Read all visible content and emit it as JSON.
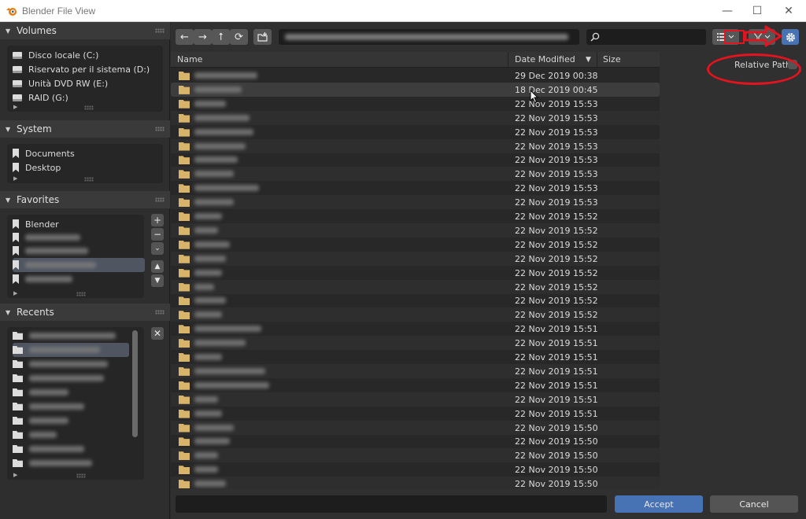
{
  "window": {
    "title": "Blender File View",
    "minimize": "—",
    "maximize": "☐",
    "close": "✕"
  },
  "sidebar": {
    "volumes": {
      "title": "Volumes",
      "items": [
        "Disco locale (C:)",
        "Riservato per il sistema (D:)",
        "Unità DVD RW (E:)",
        "RAID (G:)"
      ]
    },
    "system": {
      "title": "System",
      "items": [
        "Documents",
        "Desktop"
      ]
    },
    "favorites": {
      "title": "Favorites",
      "items": [
        "Blender"
      ]
    },
    "recents": {
      "title": "Recents"
    }
  },
  "toolbar": {
    "back": "←",
    "forward": "→",
    "parent": "⭡",
    "refresh": "⟳",
    "new_folder": "+",
    "search_placeholder": ""
  },
  "filelist": {
    "columns": {
      "name": "Name",
      "date": "Date Modified",
      "sort_arrow": "▼",
      "size": "Size"
    },
    "rows": [
      "29 Dec 2019 00:38",
      "18 Dec 2019 00:45",
      "22 Nov 2019 15:53",
      "22 Nov 2019 15:53",
      "22 Nov 2019 15:53",
      "22 Nov 2019 15:53",
      "22 Nov 2019 15:53",
      "22 Nov 2019 15:53",
      "22 Nov 2019 15:53",
      "22 Nov 2019 15:53",
      "22 Nov 2019 15:52",
      "22 Nov 2019 15:52",
      "22 Nov 2019 15:52",
      "22 Nov 2019 15:52",
      "22 Nov 2019 15:52",
      "22 Nov 2019 15:52",
      "22 Nov 2019 15:52",
      "22 Nov 2019 15:52",
      "22 Nov 2019 15:51",
      "22 Nov 2019 15:51",
      "22 Nov 2019 15:51",
      "22 Nov 2019 15:51",
      "22 Nov 2019 15:51",
      "22 Nov 2019 15:51",
      "22 Nov 2019 15:51",
      "22 Nov 2019 15:50",
      "22 Nov 2019 15:50",
      "22 Nov 2019 15:50",
      "22 Nov 2019 15:50",
      "22 Nov 2019 15:50"
    ]
  },
  "options": {
    "relative_path_label": "Relative Path",
    "relative_path_checked": false
  },
  "bottom": {
    "accept": "Accept",
    "cancel": "Cancel"
  },
  "colors": {
    "accent": "#4772b3",
    "folder": "#d8b36a",
    "annotation": "#e1141f"
  }
}
